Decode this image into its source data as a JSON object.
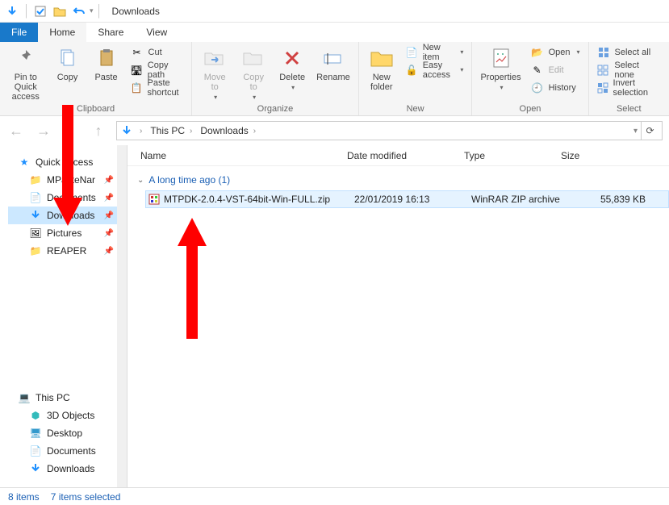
{
  "window": {
    "title": "Downloads"
  },
  "tabs": {
    "file": "File",
    "home": "Home",
    "share": "Share",
    "view": "View"
  },
  "ribbon": {
    "clipboard": {
      "label": "Clipboard",
      "pin": "Pin to Quick\naccess",
      "copy": "Copy",
      "paste": "Paste",
      "cut": "Cut",
      "copy_path": "Copy path",
      "paste_shortcut": "Paste shortcut"
    },
    "organize": {
      "label": "Organize",
      "move_to": "Move\nto",
      "copy_to": "Copy\nto",
      "delete": "Delete",
      "rename": "Rename"
    },
    "new": {
      "label": "New",
      "new_folder": "New\nfolder",
      "new_item": "New item",
      "easy_access": "Easy access"
    },
    "open": {
      "label": "Open",
      "properties": "Properties",
      "open": "Open",
      "edit": "Edit",
      "history": "History"
    },
    "select": {
      "label": "Select",
      "select_all": "Select all",
      "select_none": "Select none",
      "invert": "Invert selection"
    }
  },
  "breadcrumb": {
    "root": "This PC",
    "folder": "Downloads"
  },
  "sidebar": {
    "quick_access": "Quick access",
    "items": [
      {
        "label": "MPasteNar"
      },
      {
        "label": "Documents"
      },
      {
        "label": "Downloads"
      },
      {
        "label": "Pictures"
      },
      {
        "label": "REAPER"
      }
    ],
    "this_pc": "This PC",
    "pc_items": [
      {
        "label": "3D Objects"
      },
      {
        "label": "Desktop"
      },
      {
        "label": "Documents"
      },
      {
        "label": "Downloads"
      }
    ]
  },
  "columns": {
    "name": "Name",
    "date": "Date modified",
    "type": "Type",
    "size": "Size"
  },
  "group_header": "A long time ago (1)",
  "file": {
    "name": "MTPDK-2.0.4-VST-64bit-Win-FULL.zip",
    "date": "22/01/2019 16:13",
    "type": "WinRAR ZIP archive",
    "size": "55,839 KB"
  },
  "status": {
    "items": "8 items",
    "selected": "7 items selected"
  }
}
